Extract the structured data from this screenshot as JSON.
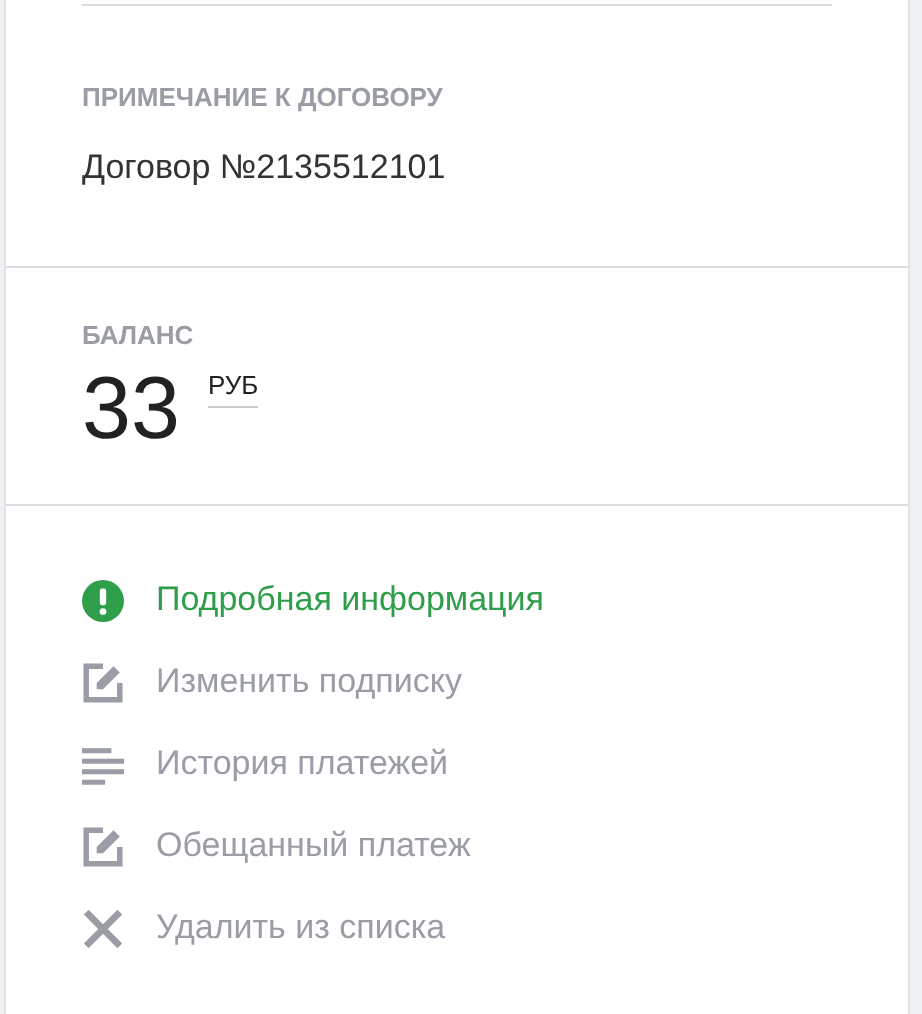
{
  "note": {
    "label": "ПРИМЕЧАНИЕ К ДОГОВОРУ",
    "value": "Договор №2135512101"
  },
  "balance": {
    "label": "БАЛАНС",
    "amount": "33",
    "currency": "РУБ"
  },
  "actions": [
    {
      "kind": "info",
      "label": "Подробная информация",
      "highlighted": true
    },
    {
      "kind": "edit",
      "label": "Изменить подписку",
      "highlighted": false
    },
    {
      "kind": "list",
      "label": "История платежей",
      "highlighted": false
    },
    {
      "kind": "edit",
      "label": "Обещанный платеж",
      "highlighted": false
    },
    {
      "kind": "close",
      "label": "Удалить из списка",
      "highlighted": false
    }
  ]
}
